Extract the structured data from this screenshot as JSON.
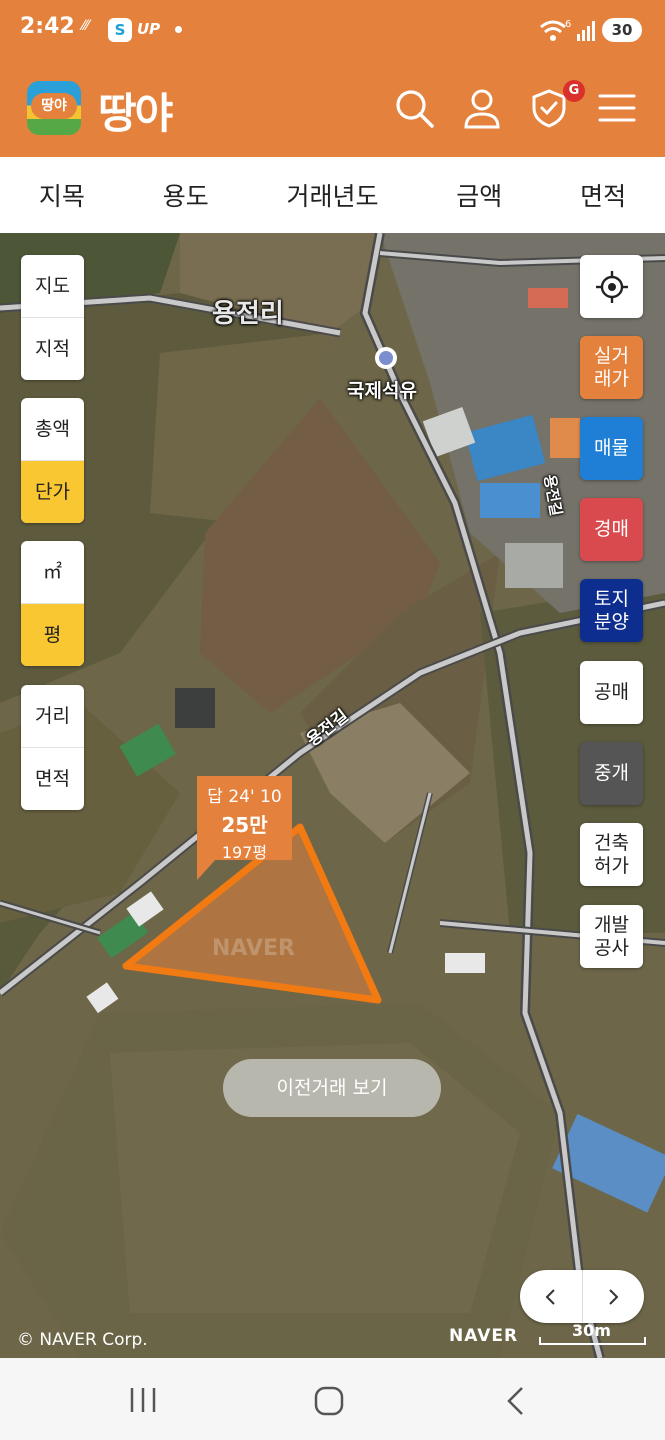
{
  "status_bar": {
    "time": "2:42",
    "app_badge": "S",
    "app_badge_text": "UP",
    "signal": "6",
    "battery": "30"
  },
  "header": {
    "logo_badge": "땅야",
    "logo_text": "땅야",
    "notification_badge": "G"
  },
  "filters": [
    "지목",
    "용도",
    "거래년도",
    "금액",
    "면적"
  ],
  "left_controls": {
    "map_types": [
      "지도",
      "지적"
    ],
    "price_modes": [
      "총액",
      "단가"
    ],
    "units": [
      "㎡",
      "평"
    ],
    "measure": [
      "거리",
      "면적"
    ]
  },
  "right_controls": {
    "actual_trade": "실거\n래가",
    "listings": "매물",
    "auction": "경매",
    "land_sale": "토지\n분양",
    "public_sale": "공매",
    "brokerage": "중개",
    "building_permit": "건축\n허가",
    "development": "개발\n공사"
  },
  "map": {
    "village_label": "용전리",
    "poi_label": "국제석유",
    "road_label_1": "용전길",
    "road_label_2": "용전길",
    "parcel_tag": {
      "line1": "답 24' 10",
      "line2": "25만",
      "line3": "197평"
    },
    "watermark": "NAVER",
    "copyright": "© NAVER Corp.",
    "naver_logo": "NAVER",
    "scale": "30m"
  },
  "previous_trades_button": "이전거래 보기",
  "colors": {
    "brand": "#e4823d",
    "active": "#f8c731",
    "listings": "#1f7fd6",
    "auction": "#d94a4f",
    "land_sale": "#0d2d8f",
    "brokerage": "#555555"
  }
}
